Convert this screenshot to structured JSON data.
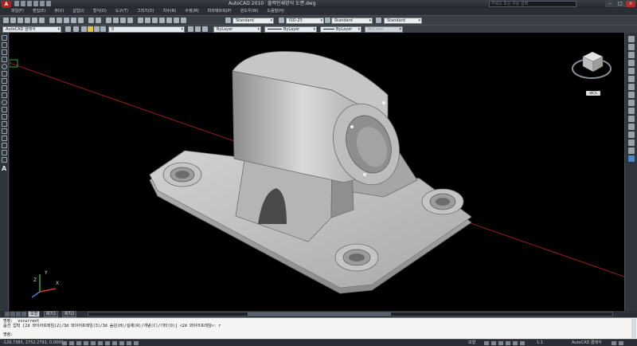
{
  "titlebar": {
    "app_title": "AutoCAD 2010",
    "file_title": "출력인쇄양식 도면.dwg",
    "search_placeholder": "키워드 또는 구문 입력"
  },
  "menu": [
    "파일(F)",
    "편집(E)",
    "뷰(V)",
    "삽입(I)",
    "형식(O)",
    "도구(T)",
    "그리기(D)",
    "치수(N)",
    "수정(M)",
    "파라메트릭(P)",
    "윈도우(W)",
    "도움말(H)"
  ],
  "toolbar1": {
    "text_style": "Standard",
    "dim_style": "ISO-25",
    "table_style": "Standard",
    "mleader_style": "Standard"
  },
  "toolbar2": {
    "workspace": "AutoCAD 클래식",
    "layer": "0",
    "color": "ByLayer",
    "linetype": "ByLayer",
    "lineweight": "ByLayer",
    "plotstyle": "ByColor"
  },
  "viewcube": {
    "label": "WCS"
  },
  "ucs": {
    "x": "X",
    "y": "Y",
    "z": "Z"
  },
  "tabs": [
    "모형",
    "배치1",
    "배치2"
  ],
  "command": {
    "line1": "명령: _vscurrent",
    "line2": "옵션 입력 [2d 와이어프레임(2)/3d 와이어프레임(3)/3d 숨김(H)/실제(R)/개념(C)/기타(O)] <2d 와이어프레임>: r",
    "prompt": "명령:"
  },
  "status": {
    "coords": "-129.7385, 2752.2791, 0.0000",
    "model": "모형",
    "scale": "1:1",
    "workspace": "AutoCAD 클래식"
  }
}
